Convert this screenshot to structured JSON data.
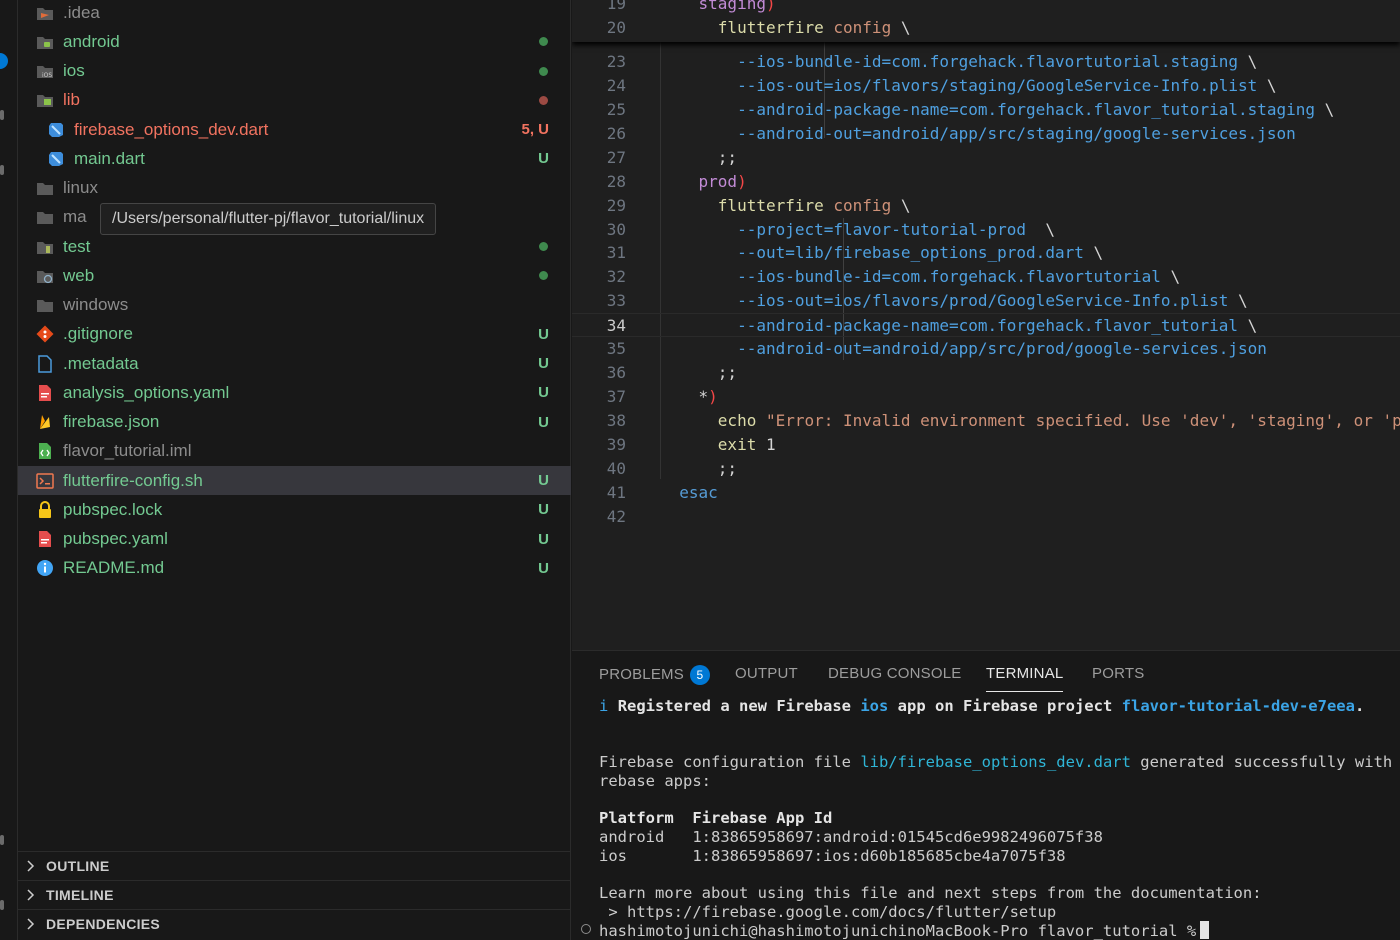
{
  "explorer": {
    "tooltip": "/Users/personal/flutter-pj/flavor_tutorial/linux",
    "items": [
      {
        "name": ".idea",
        "icon": "idea-folder-icon",
        "color": "grey",
        "status": "",
        "dot": ""
      },
      {
        "name": "android",
        "icon": "android-folder-icon",
        "color": "green",
        "status": "",
        "dot": "#3f8a4e"
      },
      {
        "name": "ios",
        "icon": "ios-folder-icon",
        "color": "green",
        "status": "",
        "dot": "#3f8a4e"
      },
      {
        "name": "lib",
        "icon": "lib-folder-icon",
        "color": "red",
        "status": "",
        "dot": "#9c4a43"
      },
      {
        "name": "firebase_options_dev.dart",
        "icon": "dart-file-icon",
        "color": "red",
        "status": "5, U",
        "dot": ""
      },
      {
        "name": "main.dart",
        "icon": "dart-file-icon",
        "color": "green",
        "status": "U",
        "dot": ""
      },
      {
        "name": "linux",
        "icon": "folder-icon",
        "color": "grey",
        "status": "",
        "dot": ""
      },
      {
        "name": "ma",
        "icon": "folder-icon",
        "color": "grey",
        "status": "",
        "dot": ""
      },
      {
        "name": "test",
        "icon": "test-folder-icon",
        "color": "green",
        "status": "",
        "dot": "#3f8a4e"
      },
      {
        "name": "web",
        "icon": "web-folder-icon",
        "color": "green",
        "status": "",
        "dot": "#3f8a4e"
      },
      {
        "name": "windows",
        "icon": "folder-icon",
        "color": "grey",
        "status": "",
        "dot": ""
      },
      {
        "name": ".gitignore",
        "icon": "git-icon",
        "color": "green",
        "status": "U",
        "dot": ""
      },
      {
        "name": ".metadata",
        "icon": "file-icon",
        "color": "green",
        "status": "U",
        "dot": ""
      },
      {
        "name": "analysis_options.yaml",
        "icon": "yaml-file-icon",
        "color": "green",
        "status": "U",
        "dot": ""
      },
      {
        "name": "firebase.json",
        "icon": "firebase-icon",
        "color": "green",
        "status": "U",
        "dot": ""
      },
      {
        "name": "flavor_tutorial.iml",
        "icon": "iml-file-icon",
        "color": "grey",
        "status": "",
        "dot": ""
      },
      {
        "name": "flutterfire-config.sh",
        "icon": "shell-file-icon",
        "color": "green",
        "status": "U",
        "dot": ""
      },
      {
        "name": "pubspec.lock",
        "icon": "lock-icon",
        "color": "green",
        "status": "U",
        "dot": ""
      },
      {
        "name": "pubspec.yaml",
        "icon": "yaml-file-icon",
        "color": "green",
        "status": "U",
        "dot": ""
      },
      {
        "name": "README.md",
        "icon": "info-icon",
        "color": "green",
        "status": "U",
        "dot": ""
      }
    ],
    "sections": [
      "OUTLINE",
      "TIMELINE",
      "DEPENDENCIES"
    ]
  },
  "editor": {
    "active_line": "34",
    "sticky": [
      {
        "ln": "19",
        "tokens": [
          [
            "    ",
            "t-plain"
          ],
          [
            "staging",
            "t-case"
          ],
          [
            ")",
            "t-paren"
          ]
        ]
      },
      {
        "ln": "20",
        "tokens": [
          [
            "      ",
            "t-plain"
          ],
          [
            "flutterfire",
            "t-cmd"
          ],
          [
            " config ",
            "t-str"
          ],
          [
            "\\",
            "t-plain"
          ]
        ]
      }
    ],
    "lines": [
      {
        "ln": "23",
        "tokens": [
          [
            "        ",
            "t-plain"
          ],
          [
            "--ios-bundle-id=com.forgehack.flavortutorial.staging",
            "t-flag"
          ],
          [
            " \\",
            "t-plain"
          ]
        ]
      },
      {
        "ln": "24",
        "tokens": [
          [
            "        ",
            "t-plain"
          ],
          [
            "--ios-out=ios/flavors/staging/GoogleService-Info.plist",
            "t-flag"
          ],
          [
            " \\",
            "t-plain"
          ]
        ]
      },
      {
        "ln": "25",
        "tokens": [
          [
            "        ",
            "t-plain"
          ],
          [
            "--android-package-name=com.forgehack.flavor_tutorial.staging",
            "t-flag"
          ],
          [
            " \\",
            "t-plain"
          ]
        ]
      },
      {
        "ln": "26",
        "tokens": [
          [
            "        ",
            "t-plain"
          ],
          [
            "--android-out=android/app/src/staging/google-services.json",
            "t-flag"
          ]
        ]
      },
      {
        "ln": "27",
        "tokens": [
          [
            "      ",
            "t-plain"
          ],
          [
            ";;",
            "t-plain"
          ]
        ]
      },
      {
        "ln": "28",
        "tokens": [
          [
            "    ",
            "t-plain"
          ],
          [
            "prod",
            "t-case"
          ],
          [
            ")",
            "t-paren"
          ]
        ]
      },
      {
        "ln": "29",
        "tokens": [
          [
            "      ",
            "t-plain"
          ],
          [
            "flutterfire",
            "t-cmd"
          ],
          [
            " config ",
            "t-str"
          ],
          [
            "\\",
            "t-plain"
          ]
        ]
      },
      {
        "ln": "30",
        "tokens": [
          [
            "        ",
            "t-plain"
          ],
          [
            "--project=flavor-tutorial-prod",
            "t-flag"
          ],
          [
            "  \\",
            "t-plain"
          ]
        ]
      },
      {
        "ln": "31",
        "tokens": [
          [
            "        ",
            "t-plain"
          ],
          [
            "--out=lib/firebase_options_prod.dart",
            "t-flag"
          ],
          [
            " \\",
            "t-plain"
          ]
        ]
      },
      {
        "ln": "32",
        "tokens": [
          [
            "        ",
            "t-plain"
          ],
          [
            "--ios-bundle-id=com.forgehack.flavortutorial",
            "t-flag"
          ],
          [
            " \\",
            "t-plain"
          ]
        ]
      },
      {
        "ln": "33",
        "tokens": [
          [
            "        ",
            "t-plain"
          ],
          [
            "--ios-out=ios/flavors/prod/GoogleService-Info.plist",
            "t-flag"
          ],
          [
            " \\",
            "t-plain"
          ]
        ]
      },
      {
        "ln": "34",
        "tokens": [
          [
            "        ",
            "t-plain"
          ],
          [
            "--android-package-name=com.forgehack.flavor_tutorial",
            "t-flag"
          ],
          [
            " \\",
            "t-plain"
          ]
        ]
      },
      {
        "ln": "35",
        "tokens": [
          [
            "        ",
            "t-plain"
          ],
          [
            "--android-out=android/app/src/prod/google-services.json",
            "t-flag"
          ]
        ]
      },
      {
        "ln": "36",
        "tokens": [
          [
            "      ",
            "t-plain"
          ],
          [
            ";;",
            "t-plain"
          ]
        ]
      },
      {
        "ln": "37",
        "tokens": [
          [
            "    ",
            "t-plain"
          ],
          [
            "*",
            "t-plain"
          ],
          [
            ")",
            "t-paren"
          ]
        ]
      },
      {
        "ln": "38",
        "tokens": [
          [
            "      ",
            "t-plain"
          ],
          [
            "echo",
            "t-cmd"
          ],
          [
            " \"Error: Invalid environment specified. Use 'dev', 'staging', or 'pro",
            "t-str"
          ]
        ]
      },
      {
        "ln": "39",
        "tokens": [
          [
            "      ",
            "t-plain"
          ],
          [
            "exit",
            "t-cmd"
          ],
          [
            " 1",
            "t-plain"
          ]
        ]
      },
      {
        "ln": "40",
        "tokens": [
          [
            "      ",
            "t-plain"
          ],
          [
            ";;",
            "t-plain"
          ]
        ]
      },
      {
        "ln": "41",
        "tokens": [
          [
            "  ",
            "t-plain"
          ],
          [
            "esac",
            "t-esac"
          ]
        ]
      },
      {
        "ln": "42",
        "tokens": []
      }
    ]
  },
  "panel": {
    "tabs": [
      {
        "label": "PROBLEMS",
        "badge": "5",
        "active": false
      },
      {
        "label": "OUTPUT",
        "badge": "",
        "active": false
      },
      {
        "label": "DEBUG CONSOLE",
        "badge": "",
        "active": false
      },
      {
        "label": "TERMINAL",
        "badge": "",
        "active": true
      },
      {
        "label": "PORTS",
        "badge": "",
        "active": false
      }
    ],
    "terminal": {
      "info_prefix": "i",
      "registered_1": "Registered a new Firebase",
      "registered_platform": "ios",
      "registered_2": "app on Firebase project",
      "registered_project": "flavor-tutorial-dev-e7eea",
      "registered_end": ".",
      "config_1": "Firebase configuration file",
      "config_file": "lib/firebase_options_dev.dart",
      "config_2": "generated successfully with",
      "config_3": "rebase apps:",
      "table_header": "Platform  Firebase App Id",
      "row_android": "android   1:83865958697:android:01545cd6e9982496075f38",
      "row_ios": "ios       1:83865958697:ios:d60b185685cbe4a7075f38",
      "learn_more": "Learn more about using this file and next steps from the documentation:",
      "docs_url": " > https://firebase.google.com/docs/flutter/setup",
      "prompt": "hashimotojunichi@hashimotojunichinoMacBook-Pro flavor_tutorial %"
    }
  }
}
